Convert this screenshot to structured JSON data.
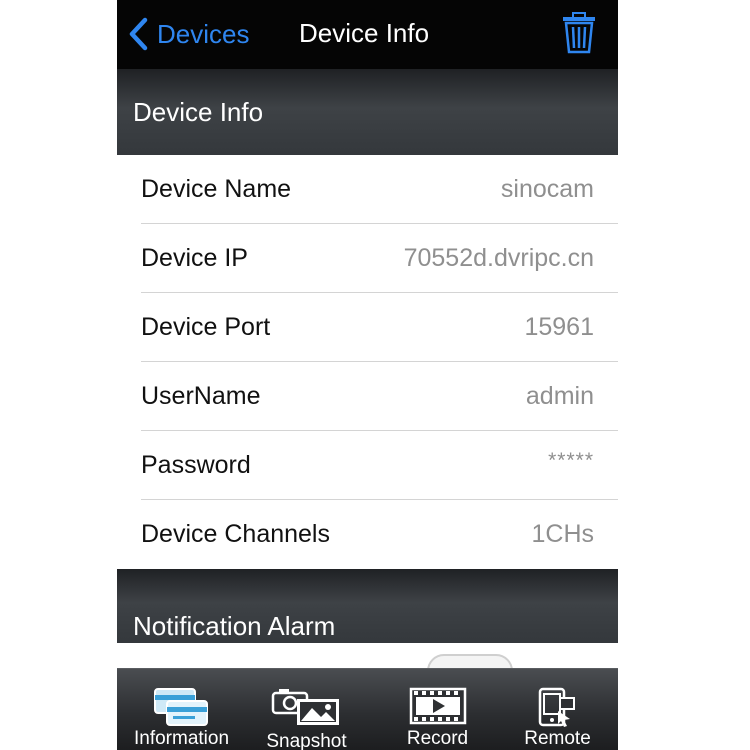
{
  "navbar": {
    "back_label": "Devices",
    "title": "Device Info",
    "back_icon": "chevron-left-icon",
    "trash_icon": "trash-icon"
  },
  "sections": {
    "device_info": "Device Info",
    "notification_alarm": "Notification Alarm"
  },
  "fields": [
    {
      "label": "Device Name",
      "value": "sinocam"
    },
    {
      "label": "Device IP",
      "value": "70552d.dvripc.cn"
    },
    {
      "label": "Device Port",
      "value": "15961"
    },
    {
      "label": "UserName",
      "value": "admin"
    },
    {
      "label": "Password",
      "value": "*****"
    },
    {
      "label": "Device Channels",
      "value": "1CHs"
    }
  ],
  "tabs": [
    {
      "label": "Information",
      "icon": "information-card-icon"
    },
    {
      "label": "Snapshot",
      "icon": "snapshot-camera-icon"
    },
    {
      "label": "Record",
      "icon": "record-film-icon"
    },
    {
      "label": "Remote",
      "icon": "remote-phone-icon"
    }
  ],
  "colors": {
    "accent": "#2f86f0",
    "navbar": "#050505",
    "value_text": "#8f8f8f"
  }
}
